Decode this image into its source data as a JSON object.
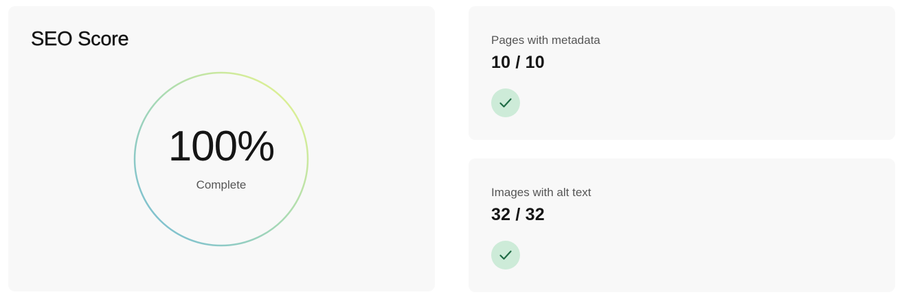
{
  "seo_score": {
    "title": "SEO Score",
    "value": "100%",
    "caption": "Complete",
    "progress_fraction": 1.0,
    "ring_gradient": [
      "#7bbfd6",
      "#a6dab3",
      "#e6f58c"
    ]
  },
  "metrics": [
    {
      "label": "Pages with metadata",
      "value": "10 / 10",
      "status_icon": "check-icon",
      "status_color": "#1f6b45",
      "badge_color": "#cdebd8"
    },
    {
      "label": "Images with alt text",
      "value": "32 / 32",
      "status_icon": "check-icon",
      "status_color": "#1f6b45",
      "badge_color": "#cdebd8"
    }
  ]
}
